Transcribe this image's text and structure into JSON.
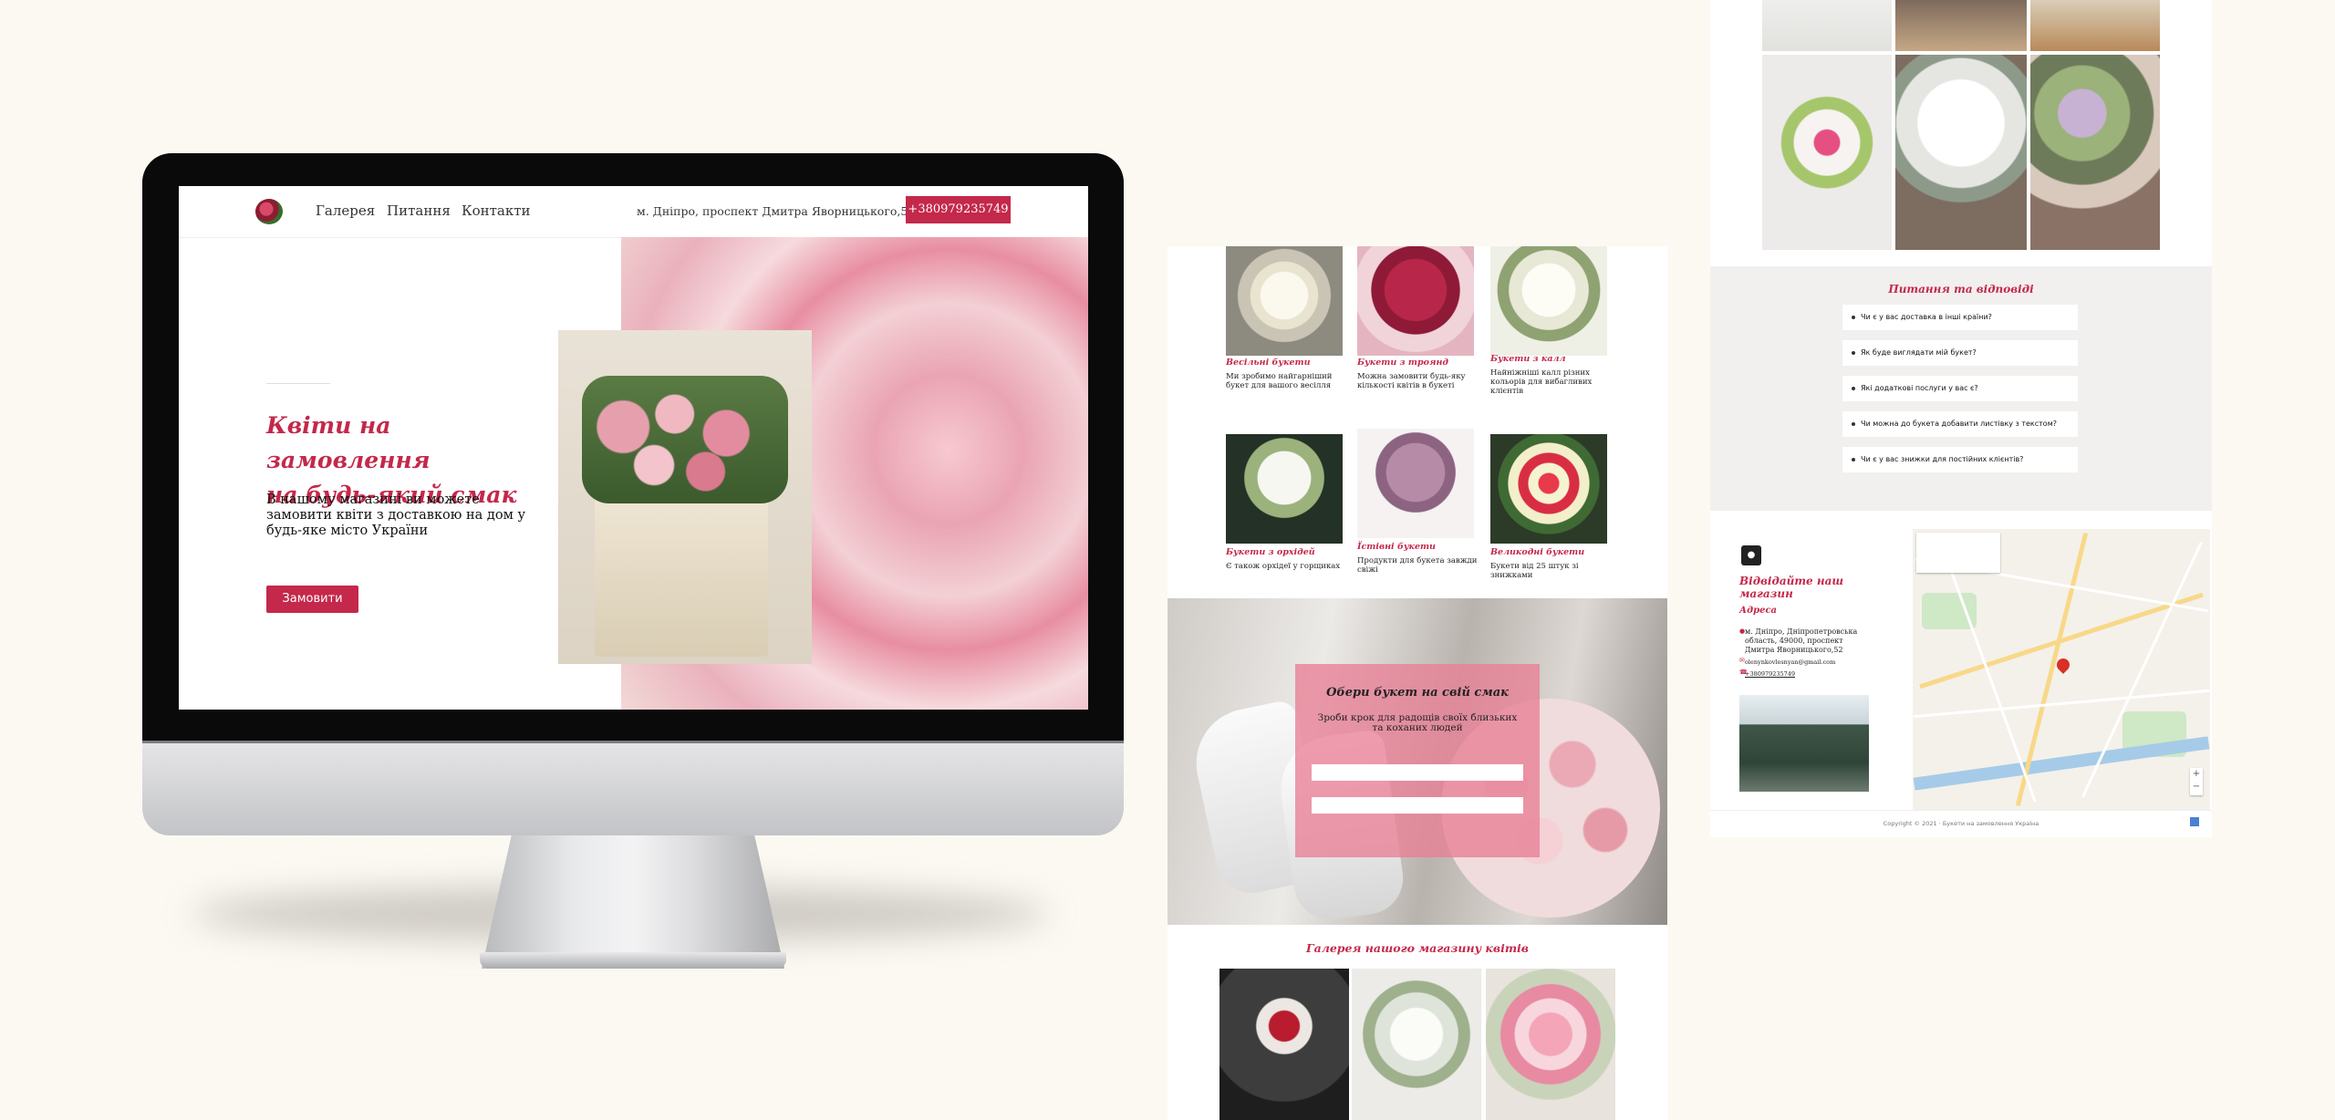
{
  "desktop": {
    "nav": {
      "items": [
        "Галерея",
        "Питання",
        "Контакти"
      ],
      "address": "м. Дніпро, проспект Дмитра Яворницького,52 .",
      "phone": "+380979235749"
    },
    "hero": {
      "title_line1": "Квіти на замовлення",
      "title_line2": "на будь-який смак",
      "text": "В нашому магазині ви можете замовити квіти з доставкою на дом у будь-яке місто України",
      "button": "Замовити"
    }
  },
  "catalog": {
    "products": [
      {
        "name": "Весільні букети",
        "desc": "Ми зробимо найгарніший букет для вашого весілля"
      },
      {
        "name": "Букети з троянд",
        "desc": "Можна замовити будь-яку кількості квітів в букеті"
      },
      {
        "name": "Букети з калл",
        "desc": "Найніжніші калл різних кольорів для вибагливих клієнтів"
      },
      {
        "name": "Букети з орхідей",
        "desc": "Є також орхідеї у горщиках"
      },
      {
        "name": "Їстівні букети",
        "desc": "Продукти для букета завжди свіжі"
      },
      {
        "name": "Великодні букети",
        "desc": "Букети від 25 штук зі знижками"
      }
    ],
    "form": {
      "title": "Обери букет на свій смак",
      "subtitle": "Зроби крок для радощів своїх близьких та коханих людей"
    },
    "gallery_title": "Галерея нашого магазину квітів"
  },
  "contacts": {
    "faq_title": "Питання та відповіді",
    "faq": [
      "Чи є у вас доставка в інші країни?",
      "Як буде виглядати мій букет?",
      "Які додаткові послуги у вас є?",
      "Чи можна до букета добавити листівку з текстом?",
      "Чи є у вас знижки для постійних клієнтів?"
    ],
    "visit_title": "Відвідайте наш магазин",
    "address_title": "Адреса",
    "address_lines": [
      "м. Дніпро, Дніпропетровська",
      "область, 49000, проспект",
      "Дмитра Яворницького,52"
    ],
    "email": "olenynkovlesnyan@gmail.com",
    "phone": "+380979235749",
    "copyright": "Copyright © 2021 · Букети на замовлення Україна"
  },
  "colors": {
    "accent": "#c4284a",
    "background": "#fcf9f3"
  }
}
